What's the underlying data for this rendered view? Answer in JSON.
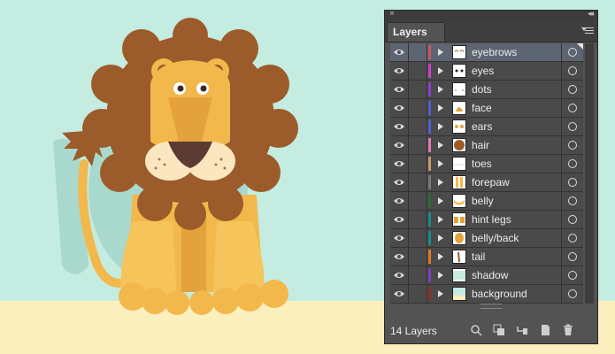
{
  "panel": {
    "tab_label": "Layers",
    "close_glyph": "×",
    "collapse_glyph": "◂◂",
    "footer_count": "14 Layers"
  },
  "layers": [
    {
      "name": "eyebrows",
      "color": "#d0575b",
      "selected": true
    },
    {
      "name": "eyes",
      "color": "#c941c9",
      "selected": false
    },
    {
      "name": "dots",
      "color": "#8a3fc8",
      "selected": false
    },
    {
      "name": "face",
      "color": "#4f5fd1",
      "selected": false
    },
    {
      "name": "ears",
      "color": "#4f5fd1",
      "selected": false
    },
    {
      "name": "hair",
      "color": "#e377b4",
      "selected": false
    },
    {
      "name": "toes",
      "color": "#c89a67",
      "selected": false
    },
    {
      "name": "forepaw",
      "color": "#7a7a7a",
      "selected": false
    },
    {
      "name": "belly",
      "color": "#2d6b34",
      "selected": false
    },
    {
      "name": "hint legs",
      "color": "#1a8a8a",
      "selected": false
    },
    {
      "name": "belly/back",
      "color": "#1a8a8a",
      "selected": false
    },
    {
      "name": "tail",
      "color": "#e07a24",
      "selected": false
    },
    {
      "name": "shadow",
      "color": "#7a3fbf",
      "selected": false
    },
    {
      "name": "background",
      "color": "#8a2e28",
      "selected": false
    }
  ],
  "colors": {
    "sky": "#c5ece0",
    "ground": "#fbefbd",
    "mane": "#9b5b2a",
    "fur": "#f2b84c",
    "fur_dark": "#e3a23c",
    "muzzle": "#fbe7bf",
    "nose": "#5b3b33"
  },
  "icons": [
    "visibility-eye-icon",
    "disclosure-triangle-icon",
    "target-circle-icon",
    "panel-menu-icon",
    "search-icon",
    "clipping-mask-icon",
    "new-sublayer-icon",
    "new-layer-icon",
    "trash-icon"
  ]
}
